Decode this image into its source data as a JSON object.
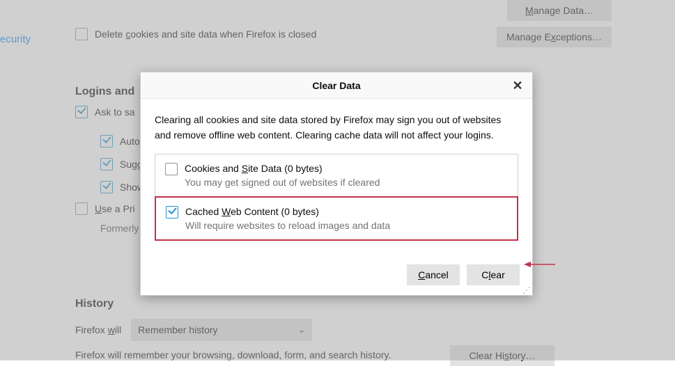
{
  "sidebar": {
    "security_link": "ecurity"
  },
  "cookies": {
    "delete_on_close": {
      "label_pre": "Delete ",
      "label_mn": "c",
      "label_post": "ookies and site data when Firefox is closed"
    },
    "manage_data": {
      "pre": "",
      "mn": "M",
      "post": "anage Data…"
    },
    "manage_exceptions": {
      "pre": "Manage E",
      "mn": "x",
      "post": "ceptions…"
    }
  },
  "logins": {
    "heading": "Logins and",
    "ask_save": "Ask to sa",
    "subs": {
      "auto": "Auto",
      "sugg": "Sugg",
      "show": "Show"
    },
    "primary": {
      "pre": "",
      "mn": "U",
      "post": "se a Pri"
    },
    "formerly": "Formerly"
  },
  "history": {
    "heading": "History",
    "will_pre": "Firefox ",
    "will_mn": "w",
    "will_post": "ill",
    "select_value": "Remember history",
    "desc": "Firefox will remember your browsing, download, form, and search history.",
    "clear_btn": {
      "pre": "Clear Hi",
      "mn": "s",
      "post": "tory…"
    }
  },
  "dialog": {
    "title": "Clear Data",
    "desc": "Clearing all cookies and site data stored by Firefox may sign you out of websites and remove offline web content. Clearing cache data will not affect your logins.",
    "opt1": {
      "title_pre": "Cookies and ",
      "title_mn": "S",
      "title_post": "ite Data (0 bytes)",
      "sub": "You may get signed out of websites if cleared",
      "checked": false
    },
    "opt2": {
      "title_pre": "Cached ",
      "title_mn": "W",
      "title_post": "eb Content (0 bytes)",
      "sub": "Will require websites to reload images and data",
      "checked": true
    },
    "cancel": {
      "mn": "C",
      "post": "ancel"
    },
    "clear": {
      "pre": "C",
      "mn": "l",
      "post": "ear"
    }
  }
}
